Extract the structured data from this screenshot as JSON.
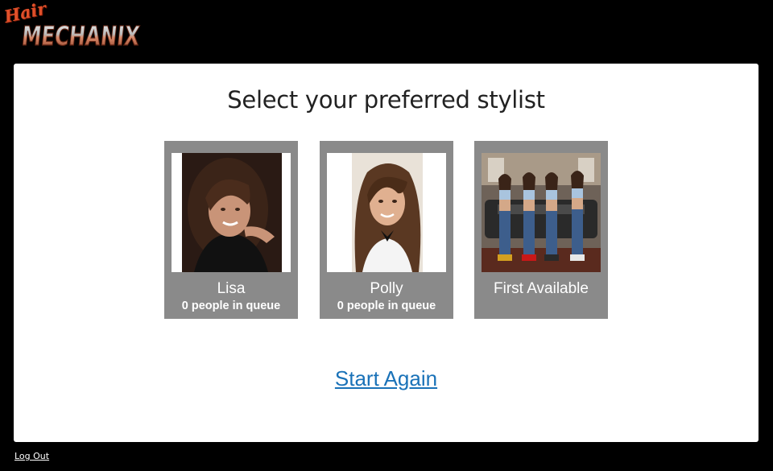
{
  "logo": {
    "script_text": "Hair",
    "main_text": "MECHANIX"
  },
  "page": {
    "title": "Select your preferred stylist"
  },
  "stylists": [
    {
      "name": "Lisa",
      "queue": "0 people in queue"
    },
    {
      "name": "Polly",
      "queue": "0 people in queue"
    },
    {
      "name": "First Available"
    }
  ],
  "actions": {
    "start_again": "Start Again",
    "log_out": "Log Out"
  },
  "colors": {
    "background": "#000000",
    "card": "#ffffff",
    "tile": "#8a8a8a",
    "link": "#1a72b8",
    "logo_accent": "#e0502a"
  }
}
